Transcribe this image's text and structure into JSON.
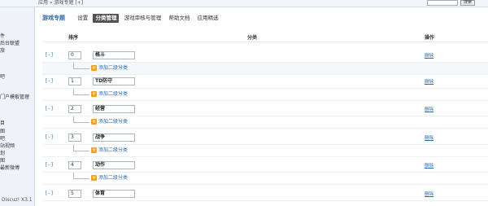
{
  "topbar": {
    "breadcrumb": "应用 » 游戏专题 [+]",
    "search_button": "搜索"
  },
  "sidebar": {
    "items": [
      "件",
      "后台联盟",
      "旅",
      "",
      "吧",
      "",
      "门户模板管理",
      "",
      "",
      "",
      "目",
      "图",
      "吧",
      "站视频",
      "划",
      "图",
      "最新微博"
    ],
    "footer": "Discuz! X3.1"
  },
  "main": {
    "plugin_title": "游戏专题",
    "tabs": [
      {
        "label": "设置",
        "active": false
      },
      {
        "label": "分类管理",
        "active": true
      },
      {
        "label": "游戏审核与管理",
        "active": false
      },
      {
        "label": "帮助文档",
        "active": false
      },
      {
        "label": "应用精选",
        "active": false
      }
    ],
    "columns": {
      "order": "排序",
      "category": "分类",
      "operation": "操作"
    },
    "toggle_text": "[-]",
    "add_sub_label": "添加二级分类",
    "delete_label": "删除",
    "rows": [
      {
        "order": "0",
        "name": "格斗"
      },
      {
        "order": "1",
        "name": "TD防守"
      },
      {
        "order": "2",
        "name": "经营"
      },
      {
        "order": "3",
        "name": "战争"
      },
      {
        "order": "4",
        "name": "动作"
      },
      {
        "order": "5",
        "name": "体育"
      }
    ]
  }
}
